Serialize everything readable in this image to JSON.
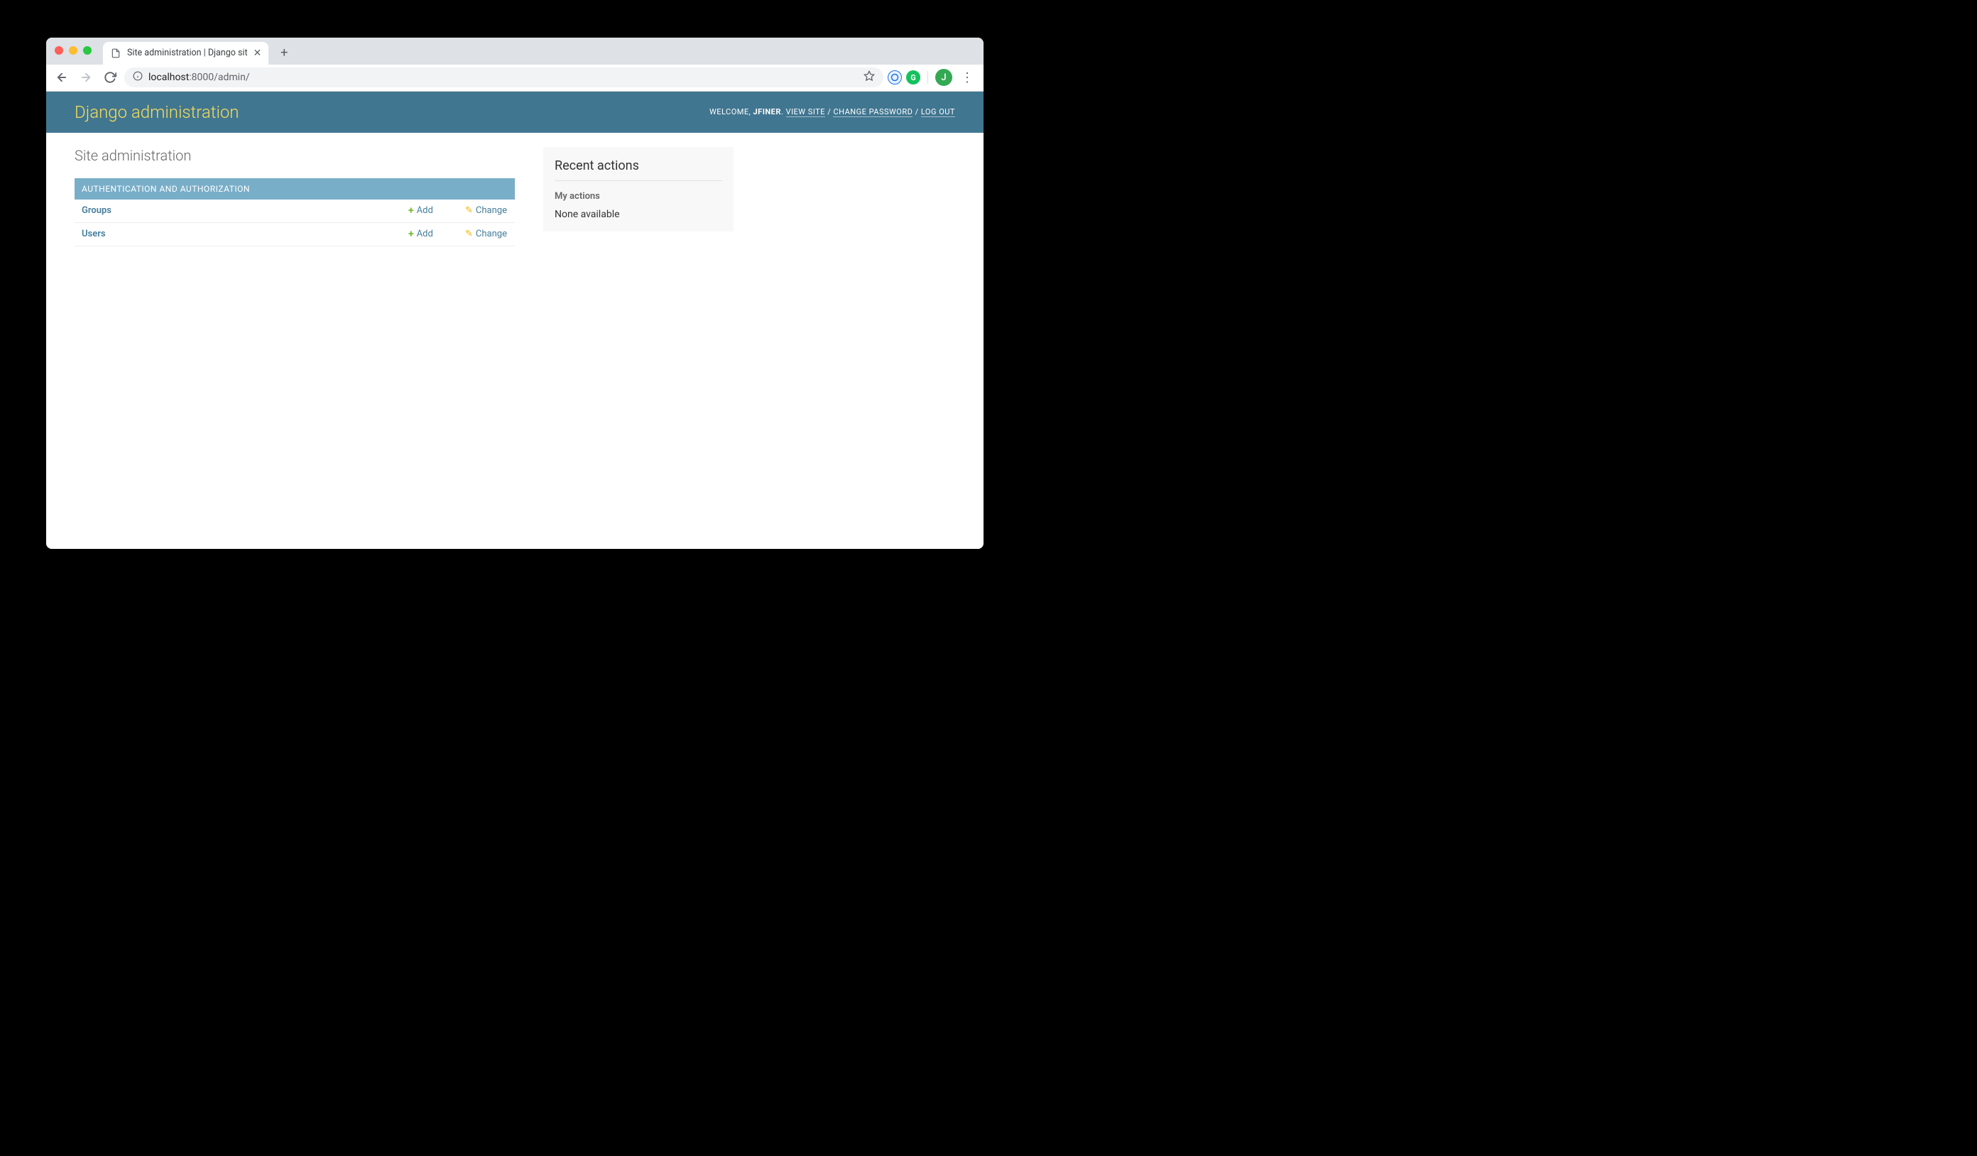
{
  "browser": {
    "tab_title": "Site administration | Django sit",
    "url_host": "localhost",
    "url_port_path": ":8000/admin/",
    "avatar_letter": "J"
  },
  "header": {
    "branding": "Django administration",
    "welcome": "WELCOME, ",
    "username": "JFINER",
    "view_site": "VIEW SITE",
    "change_password": "CHANGE PASSWORD",
    "log_out": "LOG OUT",
    "sep": " / "
  },
  "content": {
    "heading": "Site administration",
    "app": {
      "caption": "AUTHENTICATION AND AUTHORIZATION",
      "models": [
        {
          "name": "Groups",
          "add": "Add",
          "change": "Change"
        },
        {
          "name": "Users",
          "add": "Add",
          "change": "Change"
        }
      ]
    }
  },
  "sidebar": {
    "recent_actions": "Recent actions",
    "my_actions": "My actions",
    "none_available": "None available"
  }
}
